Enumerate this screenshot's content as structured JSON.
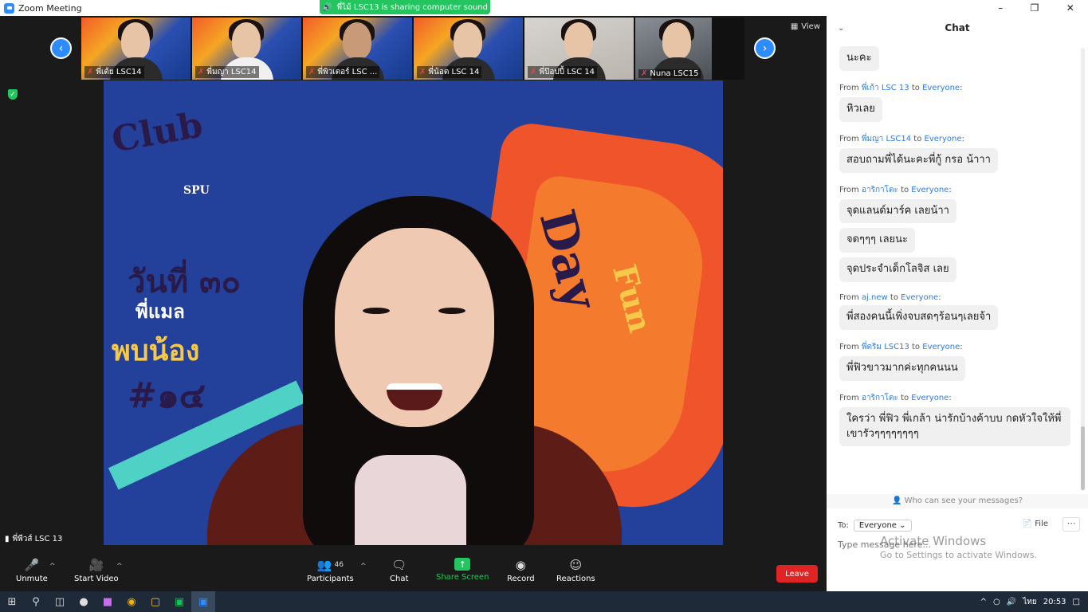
{
  "window": {
    "title": "Zoom Meeting"
  },
  "banner": {
    "text": "พี่ไม้ LSC13 is sharing computer sound"
  },
  "view_label": "View",
  "thumbnails": [
    {
      "name": "พี่เต้ย LSC14"
    },
    {
      "name": "พี่มญา LSC14"
    },
    {
      "name": "พี่พิวเตอร์ LSC ..."
    },
    {
      "name": "พี่น้อต LSC 14"
    },
    {
      "name": "พี่ป๊อปปี้ LSC 14"
    },
    {
      "name": "Nuna LSC15"
    }
  ],
  "active_speaker": {
    "name": "พี่พีวส์ LSC 13"
  },
  "background_text": {
    "line1": "วันที่ ๓๐",
    "line2": "พี่แมล",
    "line3": "พบน้อง",
    "line4": "#๑๔",
    "club": "Club",
    "fun": "Fun",
    "day": "Day",
    "spu": "SPU"
  },
  "toolbar": {
    "unmute": "Unmute",
    "start_video": "Start Video",
    "participants": "Participants",
    "participants_count": "46",
    "chat": "Chat",
    "share_screen": "Share Screen",
    "record": "Record",
    "reactions": "Reactions",
    "leave": "Leave"
  },
  "chat": {
    "header": "Chat",
    "messages": [
      {
        "from": "",
        "to": "",
        "texts": [
          "นะคะ"
        ]
      },
      {
        "from": "พี่เก้า LSC 13",
        "to": "Everyone",
        "texts": [
          "หิวเลย"
        ]
      },
      {
        "from": "พี่มญา LSC14",
        "to": "Everyone",
        "texts": [
          "สอบถามพี่ได้นะคะพี่กู้ กรอ น้าาา"
        ]
      },
      {
        "from": "อาริกาโตะ",
        "to": "Everyone",
        "texts": [
          "จุดแลนด์มาร์ค เลยน้าา",
          "จดๆๆๆ เลยนะ",
          "จุดประจำเด็กโลจิส เลย"
        ]
      },
      {
        "from": "aj.new",
        "to": "Everyone",
        "texts": [
          "พี่สองคนนี้เพิ่งจบสดๆร้อนๆเลยจ้า"
        ]
      },
      {
        "from": "พี่ตริม LSC13",
        "to": "Everyone",
        "texts": [
          "พี่ฟิวขาวมากค่ะทุกคนนน"
        ]
      },
      {
        "from": "อาริกาโตะ",
        "to": "Everyone",
        "texts": [
          "ใครว่า พี่ฟิว พี่เกล้า น่ารักบ้างค้าบบ  กดหัวใจให้พี่เขารัวๆๆๆๆๆๆๆๆ"
        ]
      }
    ],
    "from_word": "From",
    "to_word": "to",
    "who_can_see": "Who can see your messages?",
    "to_label": "To:",
    "to_value": "Everyone",
    "file_label": "File",
    "input_placeholder": "Type message here...",
    "watermark_title": "Activate Windows",
    "watermark_sub": "Go to Settings to activate Windows."
  },
  "tray": {
    "lang": "ไทย",
    "time": "20:53"
  }
}
